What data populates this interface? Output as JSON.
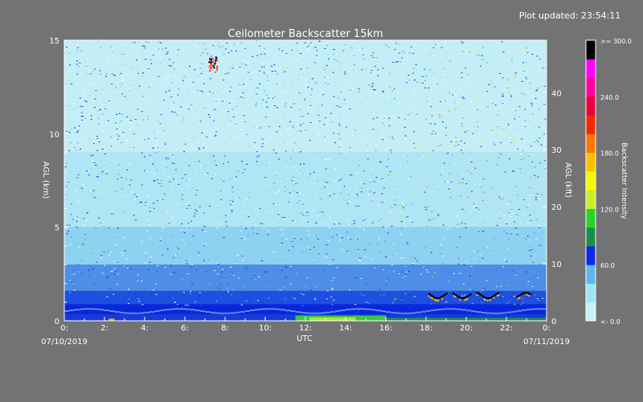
{
  "updated_text": "Plot updated: 23:54:11",
  "chart_data": {
    "type": "heatmap",
    "title": "Ceilometer Backscatter 15km",
    "xlabel": "UTC",
    "ylabel_left": "AGL (km)",
    "ylabel_right": "AGL (kft)",
    "start_date": "07/10/2019",
    "end_date": "07/11/2019",
    "x_ticks": [
      "0:",
      "2:",
      "4:",
      "6:",
      "8:",
      "10:",
      "12:",
      "14:",
      "16:",
      "18:",
      "20:",
      "22:",
      "0:"
    ],
    "xlim": [
      0,
      24
    ],
    "ylim_km": [
      0,
      15
    ],
    "y_ticks_km": [
      "0",
      "5",
      "10",
      "15"
    ],
    "ylim_kft": [
      0,
      49.2
    ],
    "y_ticks_kft": [
      "0",
      "10",
      "20",
      "30",
      "40"
    ],
    "colorbar": {
      "label": "Backscatter Intensity",
      "range": [
        0,
        300
      ],
      "tick_labels": [
        "<-  0.0",
        "60.0",
        "120.0",
        "180.0",
        "240.0",
        ">= 300.0"
      ],
      "colors": [
        "#c8f0f8",
        "#9ee4f4",
        "#60b4f0",
        "#0a28e6",
        "#1a8f4a",
        "#28d228",
        "#c8f028",
        "#f8f800",
        "#f8c000",
        "#f87800",
        "#f02800",
        "#e8003c",
        "#ff00a0",
        "#ff00ff",
        "#000000"
      ]
    },
    "features": [
      {
        "name": "boundary layer",
        "x_range": [
          0,
          24
        ],
        "height_km": [
          0,
          0.8
        ]
      },
      {
        "name": "aerosol layer",
        "x_range": [
          11.5,
          16
        ],
        "height_km": [
          0,
          0.3
        ]
      },
      {
        "name": "high cloud",
        "x_range": [
          7.2,
          7.6
        ],
        "height_km": [
          13.5,
          14.0
        ]
      },
      {
        "name": "low cloud",
        "x_range": [
          18,
          24
        ],
        "height_km": [
          1.3,
          1.6
        ]
      }
    ]
  }
}
